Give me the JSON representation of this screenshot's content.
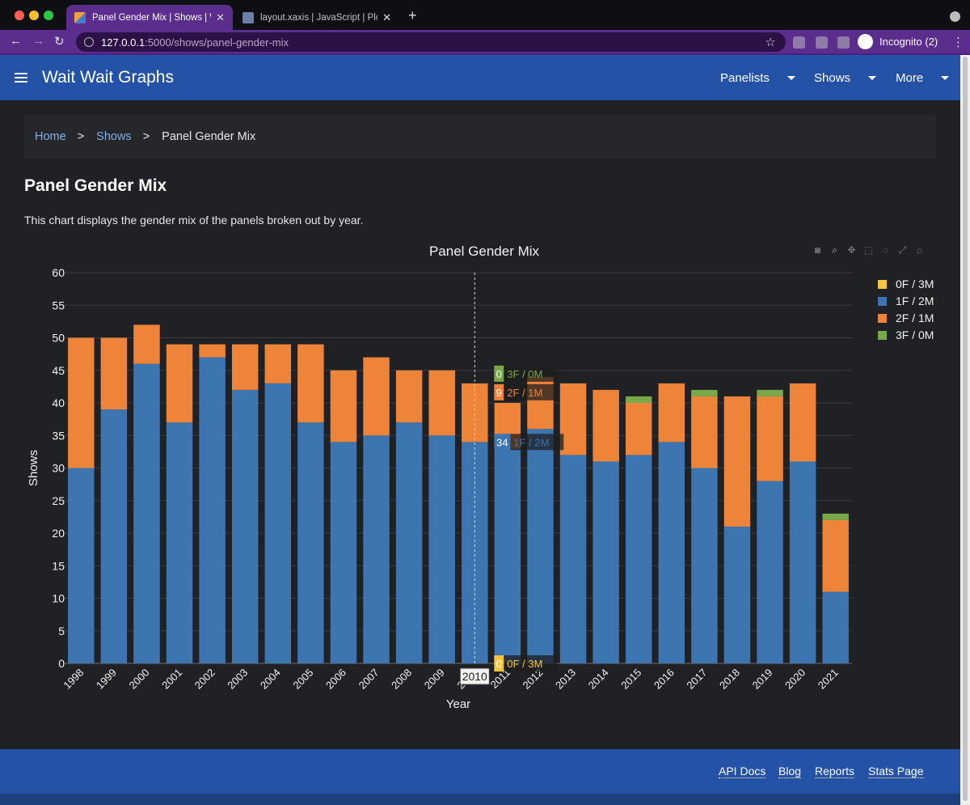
{
  "browser": {
    "active_tab_title": "Panel Gender Mix | Shows | Wait Wait Graphs",
    "inactive_tab_title": "layout.xaxis | JavaScript | Plotly",
    "url_host": "127.0.0.1",
    "url_path": ":5000/shows/panel-gender-mix",
    "incognito_label": "Incognito (2)"
  },
  "navbar": {
    "brand": "Wait Wait Graphs",
    "menus": [
      "Panelists",
      "Shows",
      "More"
    ]
  },
  "breadcrumb": {
    "items": [
      "Home",
      "Shows"
    ],
    "separator": ">",
    "current": "Panel Gender Mix"
  },
  "page": {
    "title": "Panel Gender Mix",
    "description": "This chart displays the gender mix of the panels broken out by year."
  },
  "chart_data": {
    "type": "bar",
    "barmode": "stack",
    "title": "Panel Gender Mix",
    "xlabel": "Year",
    "ylabel": "Shows",
    "ylim": [
      0,
      60
    ],
    "yticks": [
      0,
      5,
      10,
      15,
      20,
      25,
      30,
      35,
      40,
      45,
      50,
      55,
      60
    ],
    "categories": [
      "1998",
      "1999",
      "2000",
      "2001",
      "2002",
      "2003",
      "2004",
      "2005",
      "2006",
      "2007",
      "2008",
      "2009",
      "2010",
      "2011",
      "2012",
      "2013",
      "2014",
      "2015",
      "2016",
      "2017",
      "2018",
      "2019",
      "2020",
      "2021"
    ],
    "series": [
      {
        "name": "0F / 3M",
        "color": "#f6c442",
        "values": [
          0,
          0,
          0,
          0,
          0,
          0,
          0,
          0,
          0,
          0,
          0,
          0,
          0,
          0,
          0,
          0,
          0,
          0,
          0,
          0,
          0,
          0,
          0,
          0
        ]
      },
      {
        "name": "1F / 2M",
        "color": "#3c75b0",
        "values": [
          30,
          39,
          46,
          37,
          47,
          42,
          43,
          37,
          34,
          35,
          37,
          35,
          34,
          33,
          36,
          32,
          31,
          32,
          34,
          30,
          21,
          28,
          31,
          11
        ]
      },
      {
        "name": "2F / 1M",
        "color": "#ed843a",
        "values": [
          20,
          11,
          6,
          12,
          2,
          7,
          6,
          12,
          11,
          12,
          8,
          10,
          9,
          7,
          8,
          11,
          11,
          8,
          9,
          11,
          20,
          13,
          12,
          11
        ]
      },
      {
        "name": "3F / 0M",
        "color": "#79a848",
        "values": [
          0,
          0,
          0,
          0,
          0,
          0,
          0,
          0,
          0,
          0,
          0,
          0,
          0,
          0,
          0,
          0,
          0,
          1,
          0,
          1,
          0,
          1,
          0,
          1
        ]
      }
    ],
    "legend_position": "top-right",
    "hover": {
      "category": "2010",
      "labels": [
        {
          "series": "3F / 0M",
          "value": "0"
        },
        {
          "series": "2F / 1M",
          "value": "9"
        },
        {
          "series": "1F / 2M",
          "value": "34"
        },
        {
          "series": "0F / 3M",
          "value": "0"
        }
      ]
    },
    "gridlines": true,
    "background": "#202124",
    "text_color": "#f2f2f2",
    "grid_color": "#3a3b3e"
  },
  "footer": {
    "links": [
      "API Docs",
      "Blog",
      "Reports",
      "Stats Page"
    ]
  }
}
